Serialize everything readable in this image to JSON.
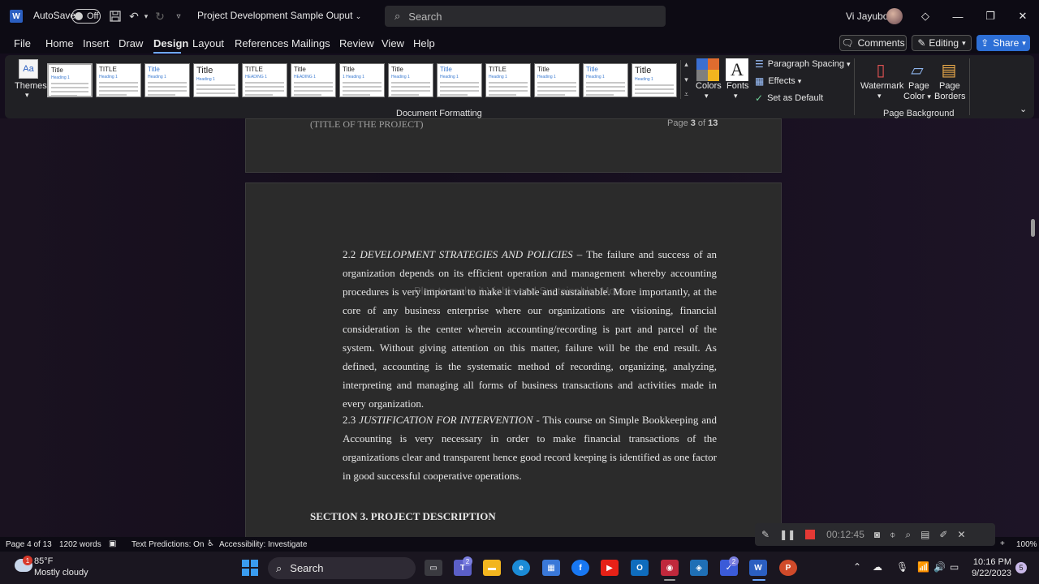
{
  "titlebar": {
    "autosave_label": "AutoSave",
    "autosave_state": "Off",
    "doc_title": "Project Development Sample Ouput",
    "search_placeholder": "Search",
    "user_name": "Vi Jayubo"
  },
  "tabs": [
    "File",
    "Home",
    "Insert",
    "Draw",
    "Design",
    "Layout",
    "References",
    "Mailings",
    "Review",
    "View",
    "Help"
  ],
  "active_tab": "Design",
  "ribbon_buttons": {
    "comments": "Comments",
    "editing": "Editing",
    "share": "Share"
  },
  "ribbon": {
    "themes_label": "Themes",
    "gallery": [
      {
        "title": "Title",
        "heading": "Heading 1"
      },
      {
        "title": "TITLE",
        "heading": "Heading 1"
      },
      {
        "title": "Title",
        "heading": "Heading 1"
      },
      {
        "title": "Title",
        "heading": "Heading 1"
      },
      {
        "title": "TITLE",
        "heading": "HEADING 1"
      },
      {
        "title": "Title",
        "heading": "HEADING 1"
      },
      {
        "title": "Title",
        "heading": "1 Heading 1"
      },
      {
        "title": "Title",
        "heading": "Heading 1"
      },
      {
        "title": "Title",
        "heading": "Heading 1"
      },
      {
        "title": "TITLE",
        "heading": "Heading 1"
      },
      {
        "title": "Title",
        "heading": "Heading 1"
      },
      {
        "title": "Title",
        "heading": "Heading 1"
      },
      {
        "title": "Title",
        "heading": "Heading 1"
      }
    ],
    "doc_formatting_label": "Document Formatting",
    "colors_label": "Colors",
    "fonts_label": "Fonts",
    "paragraph_spacing": "Paragraph Spacing",
    "effects": "Effects",
    "set_as_default": "Set as Default",
    "watermark": "Watermark",
    "page_color_1": "Page",
    "page_color_2": "Color",
    "page_borders_1": "Page",
    "page_borders_2": "Borders",
    "page_background_label": "Page Background"
  },
  "document": {
    "header_left": "(TITLE OF THE PROJECT)",
    "header_right_prefix": "Page ",
    "header_right_current": "3",
    "header_right_mid": " of ",
    "header_right_total": "13",
    "ghost_text": "Plan to make it Viable and Sustainable. More",
    "p1_number": "2.2 ",
    "p1_heading": "DEVELOPMENT STRATEGIES AND POLICIES",
    "p1_body": " – The failure and success of an organization depends on its efficient operation and management whereby accounting procedures is very important to make it viable and sustainable. More importantly, at the core of any business enterprise where our organizations are visioning, financial consideration is the center wherein accounting/recording is part and parcel of the system. Without giving attention on this matter, failure will be the end result. As defined, accounting is the systematic method of recording, organizing, analyzing, interpreting and managing all forms of business transactions and activities made in every organization.",
    "p2_number": "2.3 ",
    "p2_heading": "JUSTIFICATION FOR INTERVENTION",
    "p2_body": " - This course on Simple Bookkeeping and Accounting is very necessary in order to make financial transactions of the organizations clear and transparent hence good record keeping is identified as one factor in good successful cooperative operations.",
    "section3": "SECTION 3. PROJECT DESCRIPTION"
  },
  "statusbar": {
    "page": "Page 4 of 13",
    "words": "1202 words",
    "text_predictions": "Text Predictions: On",
    "accessibility": "Accessibility: Investigate",
    "zoom": "100%"
  },
  "recorder": {
    "time": "00:12:45"
  },
  "taskbar": {
    "weather_badge": "1",
    "temperature": "85°F",
    "weather": "Mostly cloudy",
    "search": "Search",
    "time": "10:16 PM",
    "date": "9/22/2023",
    "notifications": "5",
    "badge_teams": "2",
    "badge_tasks": "2"
  },
  "colors": {
    "accent": "#2d6fd6",
    "record": "#e53935"
  }
}
